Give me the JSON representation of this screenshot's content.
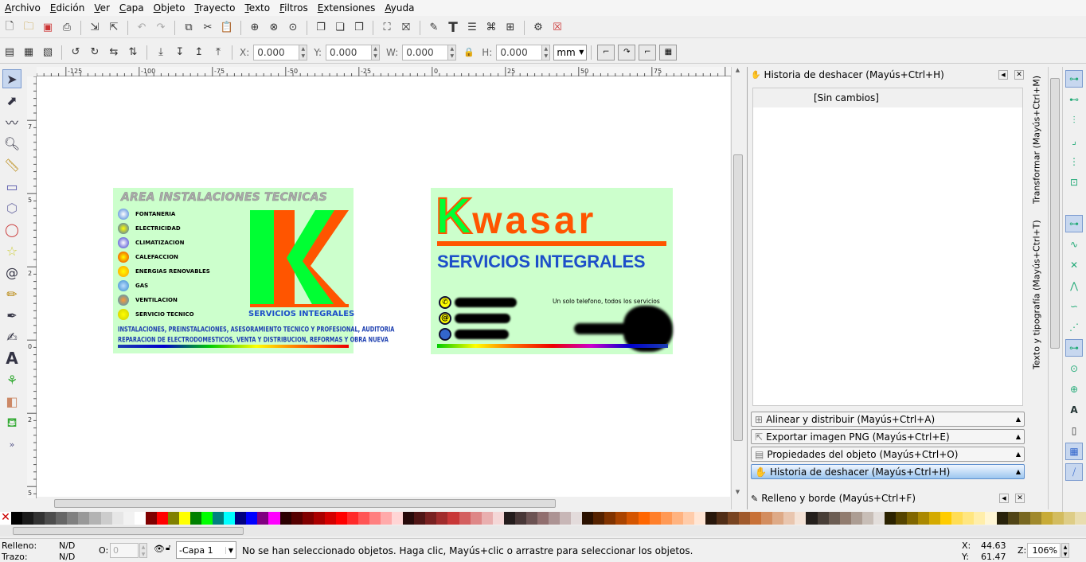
{
  "menu": [
    "Archivo",
    "Edición",
    "Ver",
    "Capa",
    "Objeto",
    "Trayecto",
    "Texto",
    "Filtros",
    "Extensiones",
    "Ayuda"
  ],
  "toolbar2": {
    "x_label": "X:",
    "x_value": "0.000",
    "y_label": "Y:",
    "y_value": "0.000",
    "w_label": "W:",
    "w_value": "0.000",
    "h_label": "H:",
    "h_value": "0.000",
    "unit": "mm"
  },
  "ruler_h": [
    "-125",
    "-100",
    "-75",
    "-50",
    "-25",
    "0",
    "25",
    "50",
    "75"
  ],
  "ruler_v": [
    "7",
    "5",
    "2",
    "0",
    "2",
    "5"
  ],
  "panel": {
    "history_title": "Historia de deshacer (Mayús+Ctrl+H)",
    "history_entry": "[Sin cambios]",
    "docks": [
      {
        "label": "Alinear y distribuir (Mayús+Ctrl+A)",
        "active": false
      },
      {
        "label": "Exportar imagen PNG (Mayús+Ctrl+E)",
        "active": false
      },
      {
        "label": "Propiedades del objeto (Mayús+Ctrl+O)",
        "active": false
      },
      {
        "label": "Historia de deshacer (Mayús+Ctrl+H)",
        "active": true
      }
    ],
    "fill_stroke_title": "Relleno y borde (Mayús+Ctrl+F)"
  },
  "vtabs": {
    "transform": "Transformar (Mayús+Ctrl+M)",
    "text": "Texto y tipografía (Mayús+Ctrl+T)"
  },
  "card1": {
    "header": "AREA INSTALACIONES TECNICAS",
    "items": [
      "FONTANERIA",
      "ELECTRICIDAD",
      "CLIMATIZACION",
      "CALEFACCION",
      "ENERGIAS RENOVABLES",
      "GAS",
      "VENTILACION",
      "SERVICIO TECNICO"
    ],
    "logo_letter": "K",
    "logo_sub": "SERVICIOS INTEGRALES",
    "footer1": "INSTALACIONES, PREINSTALACIONES, ASESORAMIENTO TECNICO Y PROFESIONAL, AUDITORIA",
    "footer2": "REPARACION DE ELECTRODOMESTICOS, VENTA Y DISTRIBUCION, REFORMAS Y OBRA NUEVA"
  },
  "card2": {
    "brand_k": "K",
    "brand_rest": "wasar",
    "subtitle": "SERVICIOS INTEGRALES",
    "slogan": "Un solo telefono, todos los servicios"
  },
  "status": {
    "fill_label": "Relleno:",
    "fill_value": "N/D",
    "stroke_label": "Trazo:",
    "stroke_value": "N/D",
    "opacity_label": "O:",
    "opacity_value": "0",
    "layer": "-Capa 1",
    "message": "No se han seleccionado objetos. Haga clic, Mayús+clic o arrastre para seleccionar los objetos.",
    "x_label": "X:",
    "x_value": "44.63",
    "y_label": "Y:",
    "y_value": "61.47",
    "zoom_label": "Z:",
    "zoom_value": "106%"
  },
  "palette_colors": [
    "#000000",
    "#1a1a1a",
    "#333333",
    "#4d4d4d",
    "#666666",
    "#808080",
    "#999999",
    "#b3b3b3",
    "#cccccc",
    "#e6e6e6",
    "#f2f2f2",
    "#ffffff",
    "#800000",
    "#ff0000",
    "#808000",
    "#ffff00",
    "#008000",
    "#00ff00",
    "#008080",
    "#00ffff",
    "#000080",
    "#0000ff",
    "#800080",
    "#ff00ff",
    "#2b0000",
    "#550000",
    "#800000",
    "#aa0000",
    "#d40000",
    "#ff0000",
    "#ff2a2a",
    "#ff5555",
    "#ff8080",
    "#ffaaaa",
    "#ffd5d5",
    "#280b0b",
    "#501616",
    "#782121",
    "#a02c2c",
    "#c83737",
    "#d35f5f",
    "#de8787",
    "#e9afaf",
    "#f4d7d7",
    "#241c1c",
    "#483737",
    "#6c5353",
    "#916f6f",
    "#ac9393",
    "#c8b7b7",
    "#e3dbdb",
    "#2b1100",
    "#552200",
    "#803300",
    "#aa4400",
    "#d45500",
    "#ff6600",
    "#ff7f2a",
    "#ff9955",
    "#ffb380",
    "#ffccaa",
    "#ffe6d5",
    "#28170b",
    "#502d16",
    "#784421",
    "#a05a2c",
    "#c87137",
    "#d38d5f",
    "#deaa87",
    "#e9c6af",
    "#f4e3d7",
    "#241f1c",
    "#483e37",
    "#6c5d53",
    "#917c6f",
    "#ac9d93",
    "#c8beb7",
    "#e3dedb",
    "#2b2200",
    "#554400",
    "#806600",
    "#aa8800",
    "#d4aa00",
    "#ffcc00",
    "#ffdd55",
    "#ffe680",
    "#ffeeaa",
    "#fff6d5",
    "#28220b",
    "#504416",
    "#786721",
    "#a0892c",
    "#c8ab37",
    "#d3bc5f",
    "#decd87",
    "#e9ddaf"
  ]
}
